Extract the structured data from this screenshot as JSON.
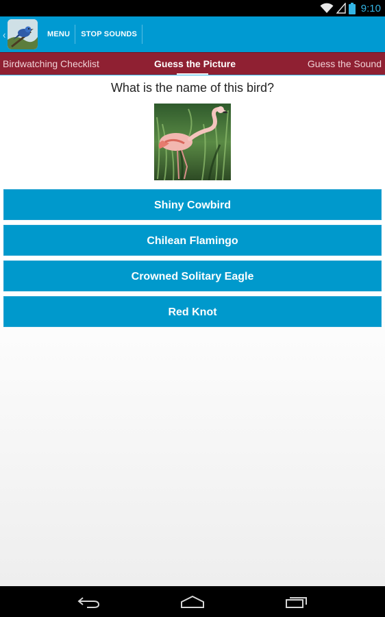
{
  "status_bar": {
    "time": "9:10",
    "icons": [
      "wifi-icon",
      "signal-icon",
      "battery-icon"
    ],
    "accent_color": "#33b5e5"
  },
  "action_bar": {
    "up_icon": "chevron-left-icon",
    "app_icon": "bird-app-icon",
    "buttons": [
      {
        "label": "MENU"
      },
      {
        "label": "STOP SOUNDS"
      }
    ],
    "color": "#009ad2"
  },
  "tabs": {
    "items": [
      {
        "label": "Birdwatching Checklist"
      },
      {
        "label": "Guess the Picture",
        "selected": true
      },
      {
        "label": "Guess the Sound"
      }
    ],
    "color": "#8f2032"
  },
  "quiz": {
    "question": "What is the name of this bird?",
    "image": "flamingo-photo",
    "answers": [
      {
        "label": "Shiny Cowbird"
      },
      {
        "label": "Chilean Flamingo"
      },
      {
        "label": "Crowned Solitary Eagle"
      },
      {
        "label": "Red Knot"
      }
    ],
    "button_color": "#0099cc"
  },
  "nav_bar": {
    "buttons": [
      "back-icon",
      "home-icon",
      "recent-apps-icon"
    ]
  }
}
